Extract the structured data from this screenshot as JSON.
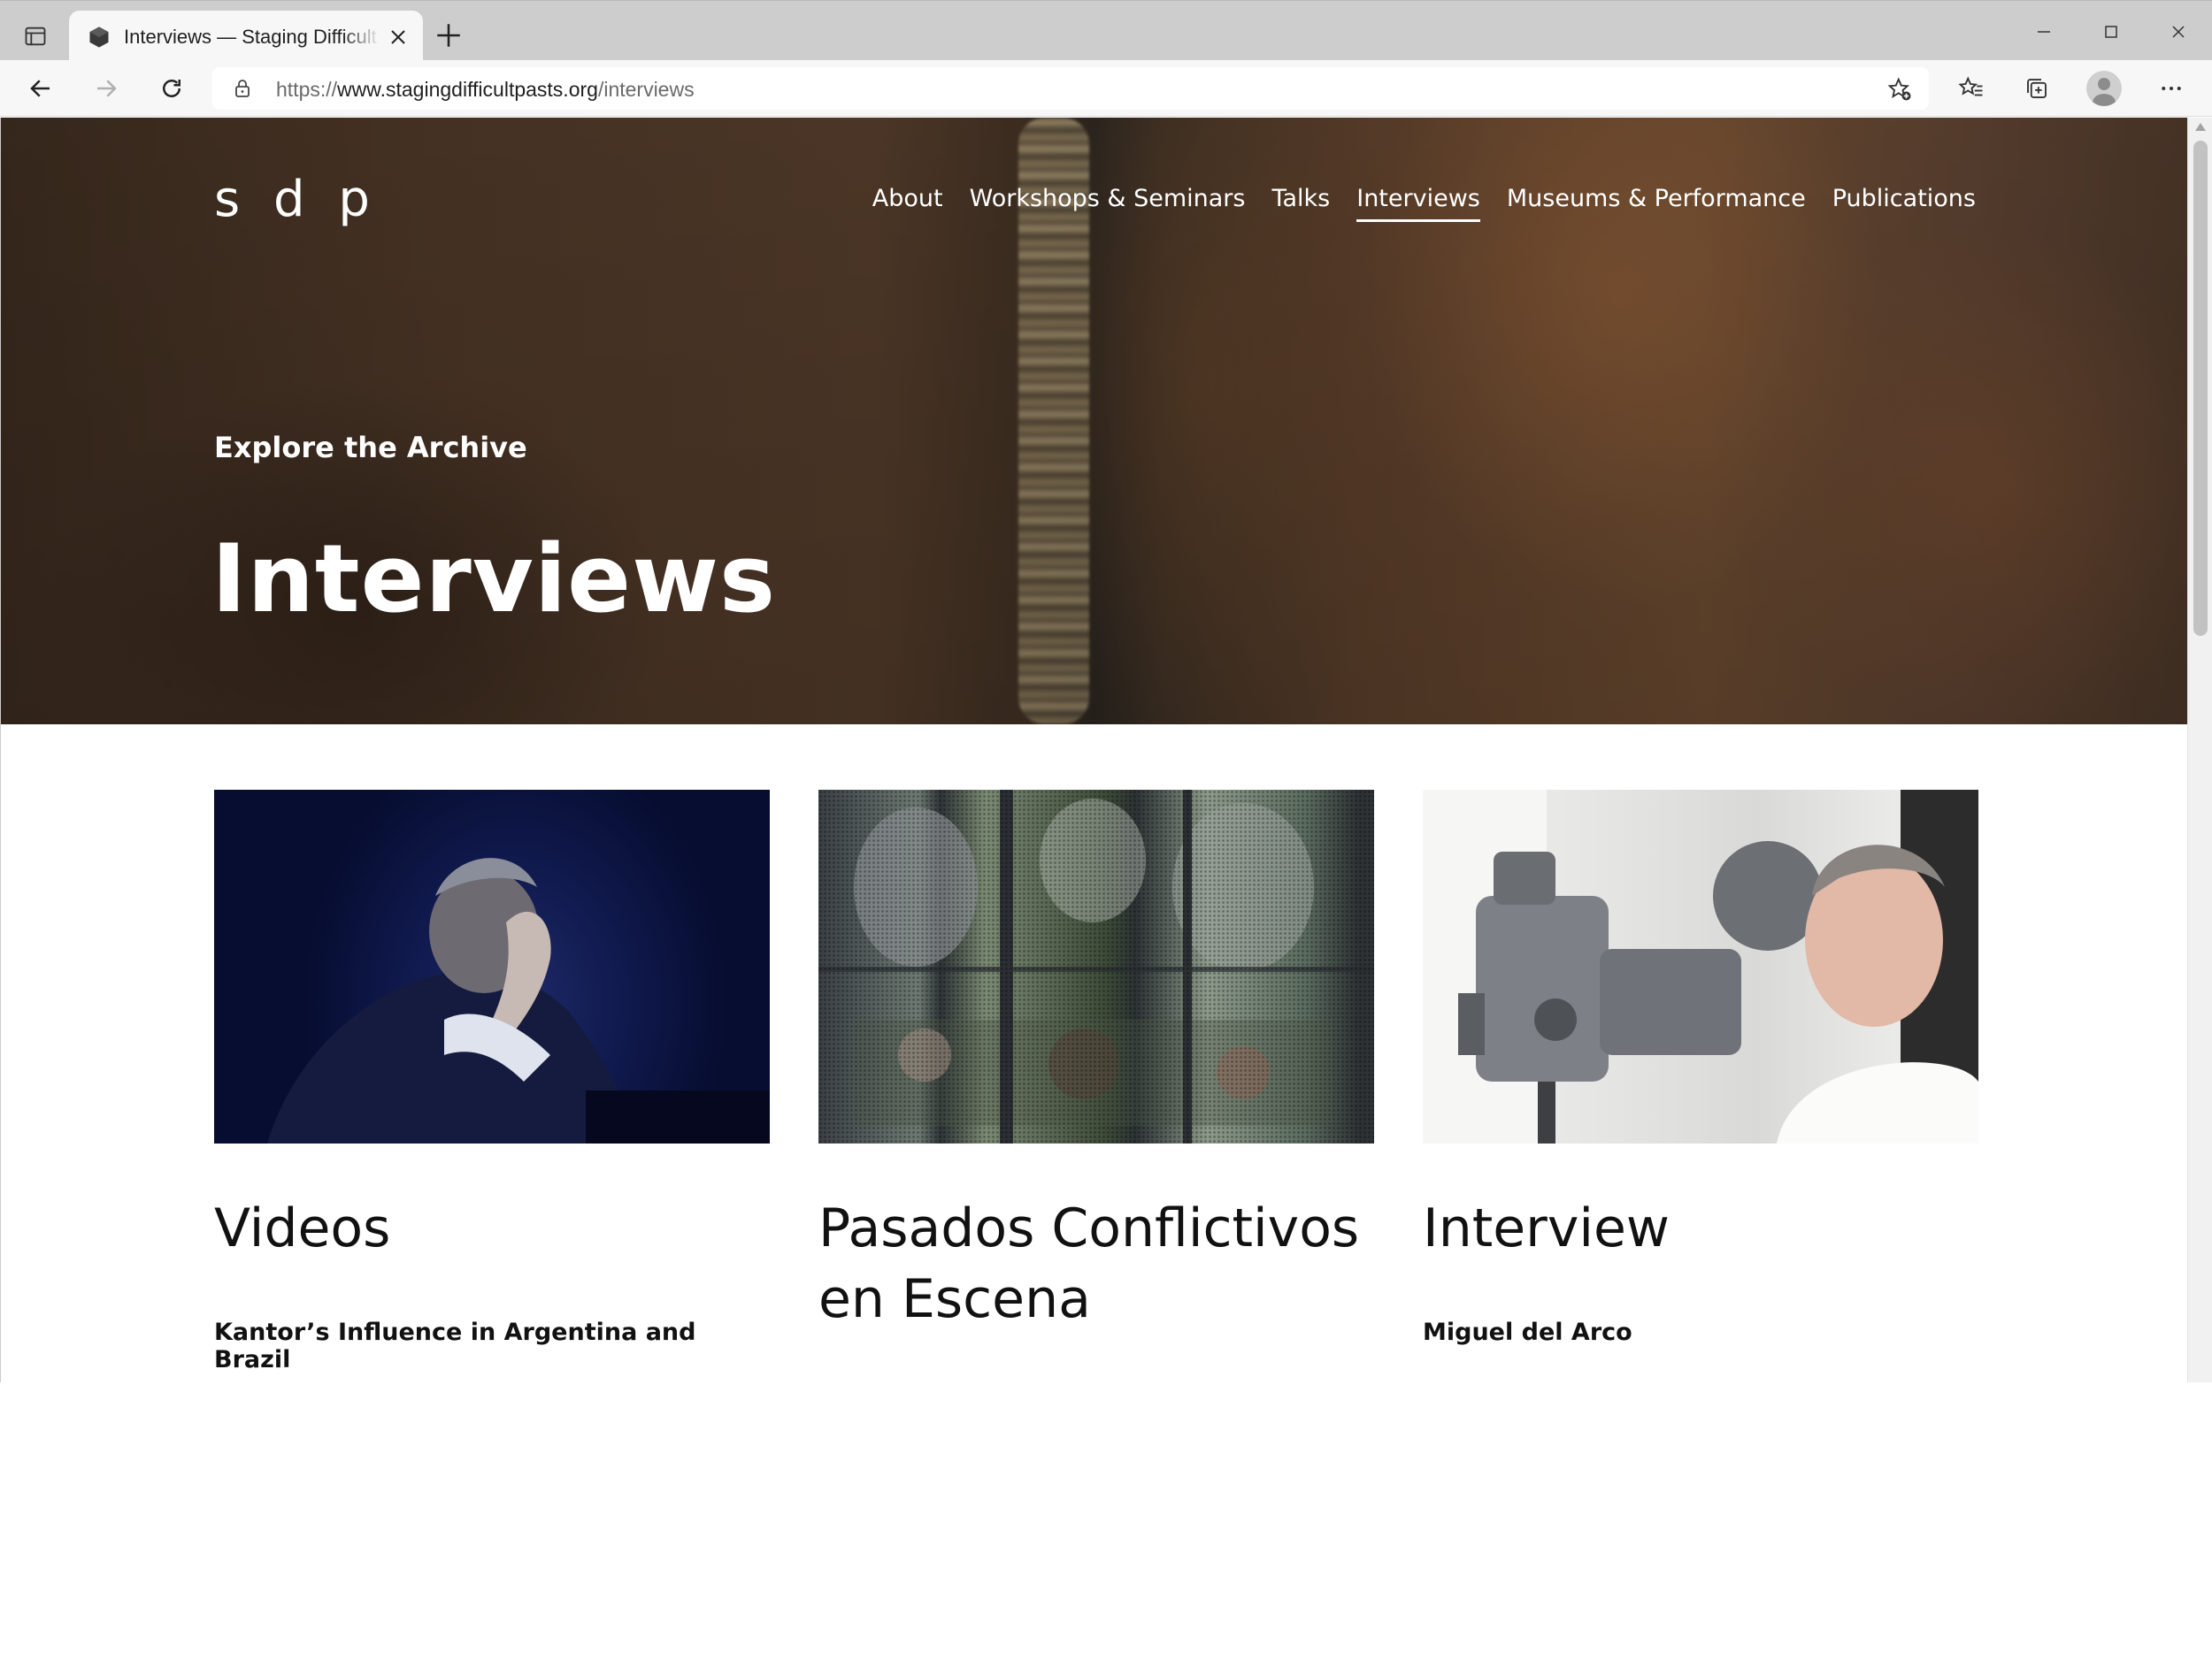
{
  "browser": {
    "tab_title": "Interviews — Staging Difficult Pasts",
    "url_scheme": "https://",
    "url_host": "www.stagingdifficultpasts.org",
    "url_path": "/interviews"
  },
  "site": {
    "logo": "s d p",
    "nav": [
      {
        "label": "About"
      },
      {
        "label": "Workshops & Seminars"
      },
      {
        "label": "Talks"
      },
      {
        "label": "Interviews",
        "active": true
      },
      {
        "label": "Museums & Performance"
      },
      {
        "label": "Publications"
      }
    ]
  },
  "hero": {
    "kicker": "Explore the Archive",
    "title": "Interviews"
  },
  "cards": [
    {
      "title": "Videos",
      "subtitle": "Kantor’s Influence in Argentina and Brazil"
    },
    {
      "title": "Pasados Conflictivos en Escena",
      "subtitle": ""
    },
    {
      "title": "Interview",
      "subtitle": "Miguel del Arco"
    }
  ]
}
